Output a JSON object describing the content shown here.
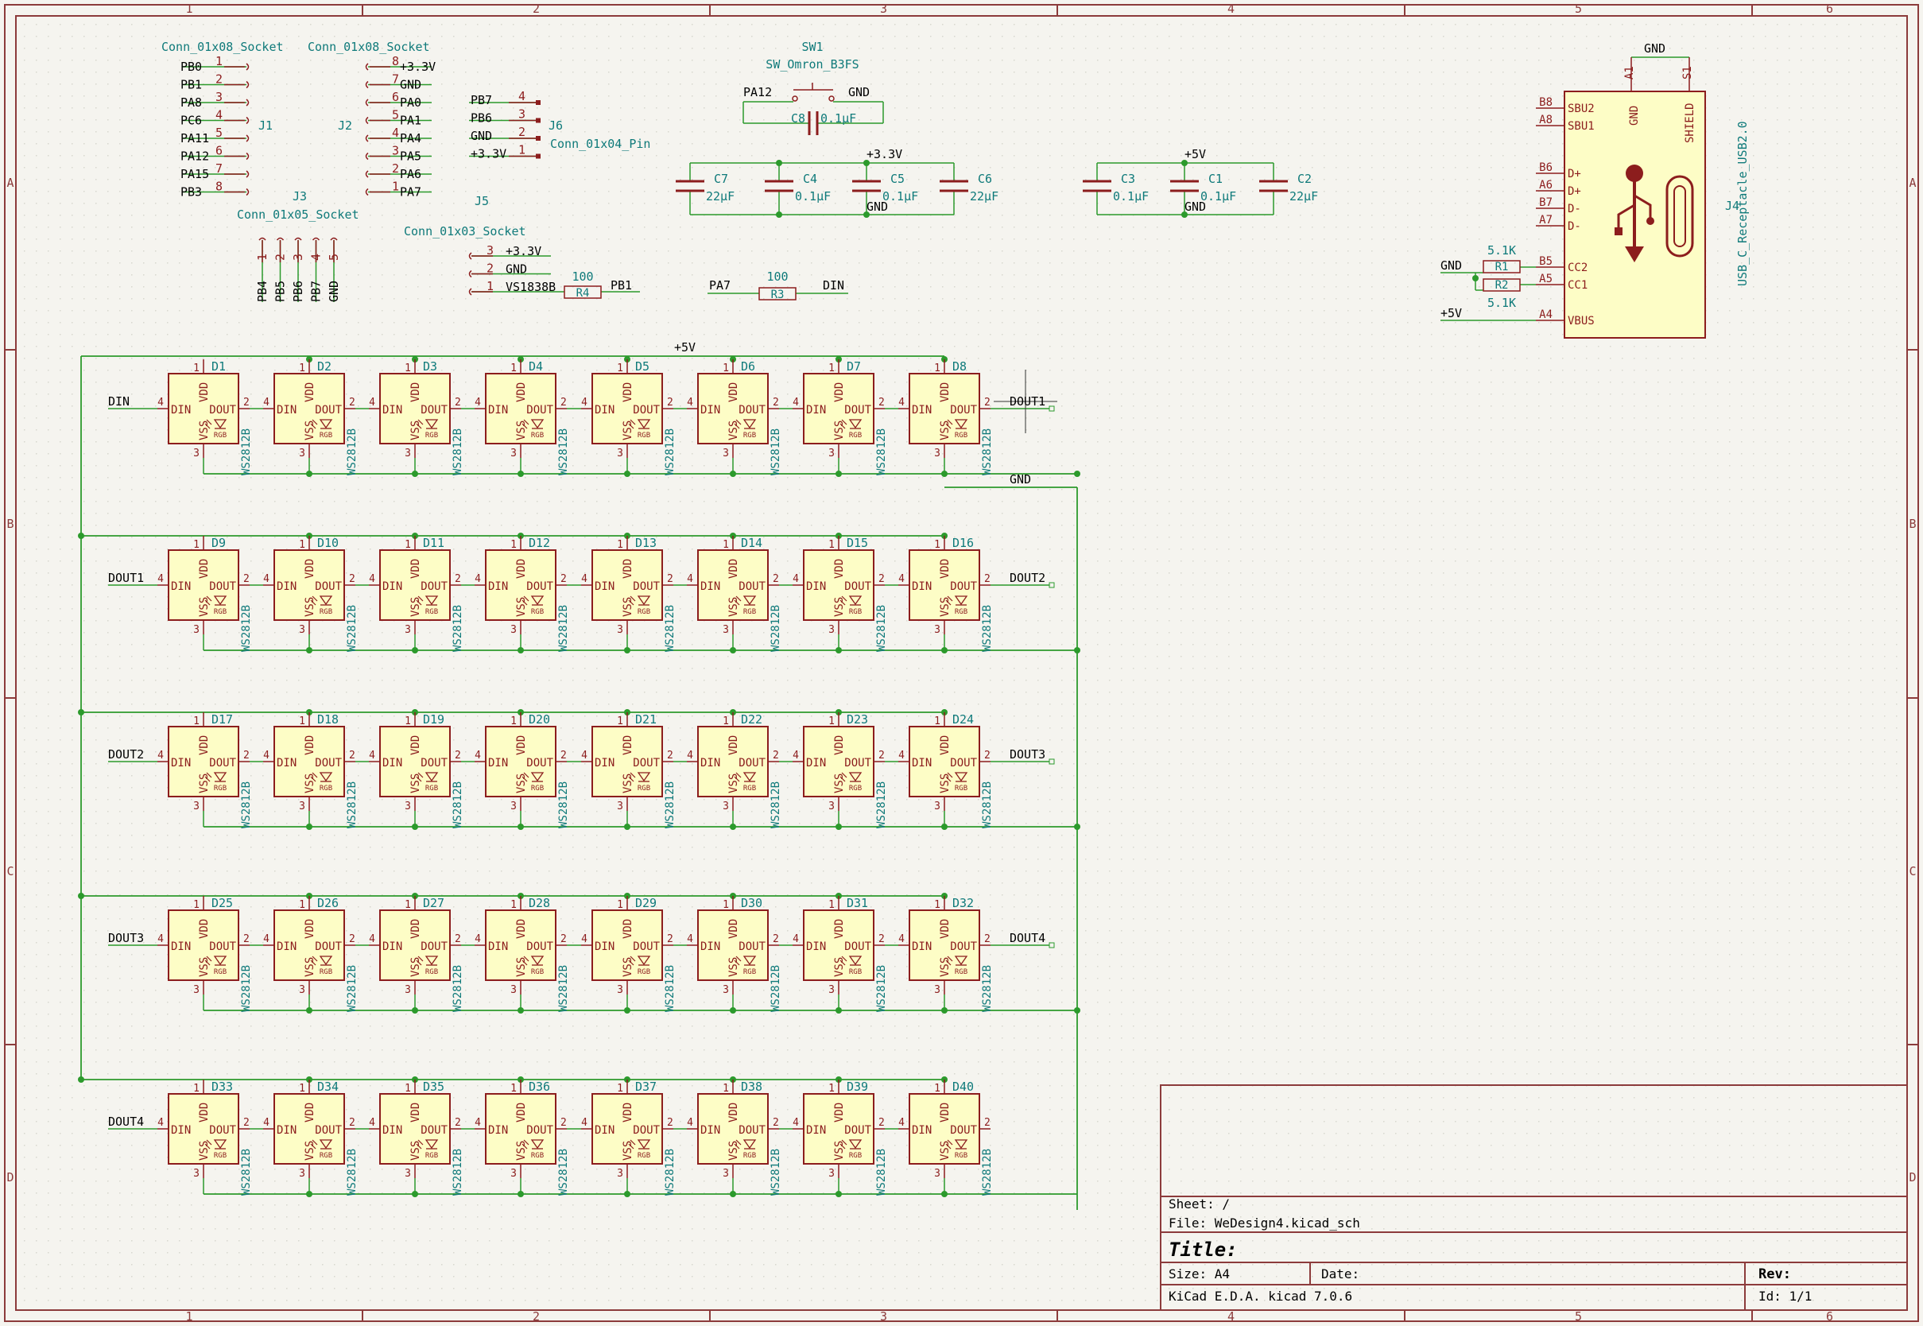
{
  "frame": {
    "col_labels": [
      "1",
      "2",
      "3",
      "4",
      "5",
      "6"
    ],
    "row_labels": [
      "A",
      "B",
      "C",
      "D"
    ]
  },
  "colors": {
    "background": "#f5f4ef",
    "border": "#8c3b3b",
    "wire": "#2c9a2c",
    "symbol_outline": "#8c1d1d",
    "symbol_fill": "#fdfdc6",
    "ref_text": "#0f7a7a",
    "pin_text": "#8c1d1d",
    "label_text": "#000000"
  },
  "connectors": {
    "j1": {
      "ref": "J1",
      "value": "Conn_01x08_Socket",
      "pins": [
        {
          "num": "1",
          "net": "PB0"
        },
        {
          "num": "2",
          "net": "PB1"
        },
        {
          "num": "3",
          "net": "PA8"
        },
        {
          "num": "4",
          "net": "PC6"
        },
        {
          "num": "5",
          "net": "PA11"
        },
        {
          "num": "6",
          "net": "PA12"
        },
        {
          "num": "7",
          "net": "PA15"
        },
        {
          "num": "8",
          "net": "PB3"
        }
      ]
    },
    "j2": {
      "ref": "J2",
      "value": "Conn_01x08_Socket",
      "pins": [
        {
          "num": "8",
          "net": "+3.3V"
        },
        {
          "num": "7",
          "net": "GND"
        },
        {
          "num": "6",
          "net": "PA0"
        },
        {
          "num": "5",
          "net": "PA1"
        },
        {
          "num": "4",
          "net": "PA4"
        },
        {
          "num": "3",
          "net": "PA5"
        },
        {
          "num": "2",
          "net": "PA6"
        },
        {
          "num": "1",
          "net": "PA7"
        }
      ]
    },
    "j3": {
      "ref": "J3",
      "value": "Conn_01x05_Socket",
      "pins": [
        {
          "num": "1",
          "net": "PB4"
        },
        {
          "num": "2",
          "net": "PB5"
        },
        {
          "num": "3",
          "net": "PB6"
        },
        {
          "num": "4",
          "net": "PB7"
        },
        {
          "num": "5",
          "net": "GND"
        }
      ]
    },
    "j5": {
      "ref": "J5",
      "value": "Conn_01x03_Socket",
      "pins": [
        {
          "num": "3",
          "net": "+3.3V"
        },
        {
          "num": "2",
          "net": "GND"
        },
        {
          "num": "1",
          "net": "VS1838B"
        }
      ]
    },
    "j6": {
      "ref": "J6",
      "value": "Conn_01x04_Pin",
      "pins": [
        {
          "num": "4",
          "net": "PB7"
        },
        {
          "num": "3",
          "net": "PB6"
        },
        {
          "num": "2",
          "net": "GND"
        },
        {
          "num": "1",
          "net": "+3.3V"
        }
      ]
    }
  },
  "resistors": {
    "r4": {
      "ref": "R4",
      "value": "100",
      "net_out": "PB1"
    },
    "r3": {
      "ref": "R3",
      "value": "100",
      "net_in": "PA7",
      "net_out": "DIN"
    },
    "r1": {
      "ref": "R1",
      "value": "5.1K"
    },
    "r2": {
      "ref": "R2",
      "value": "5.1K"
    }
  },
  "switch": {
    "ref": "SW1",
    "value": "SW_Omron_B3FS",
    "net_left": "PA12",
    "net_right": "GND"
  },
  "caps": {
    "c8": {
      "ref": "C8",
      "value": "0.1μF"
    },
    "c7": {
      "ref": "C7",
      "value": "22μF"
    },
    "c4": {
      "ref": "C4",
      "value": "0.1μF"
    },
    "c5": {
      "ref": "C5",
      "value": "0.1μF"
    },
    "c6": {
      "ref": "C6",
      "value": "22μF"
    },
    "c3": {
      "ref": "C3",
      "value": "0.1μF"
    },
    "c1": {
      "ref": "C1",
      "value": "0.1μF"
    },
    "c2": {
      "ref": "C2",
      "value": "22μF"
    },
    "bank1_top_net": "+3.3V",
    "bank1_bot_net": "GND",
    "bank2_top_net": "+5V",
    "bank2_bot_net": "GND"
  },
  "usb": {
    "ref": "J4",
    "value": "USB_C_Receptacle_USB2.0",
    "top_net": "GND",
    "top_pins": [
      {
        "num": "A1",
        "name": "GND"
      },
      {
        "num": "S1",
        "name": "SHIELD"
      }
    ],
    "left_pins": [
      {
        "num": "B8",
        "name": "SBU2"
      },
      {
        "num": "A8",
        "name": "SBU1"
      },
      {
        "num": "B6",
        "name": "D+"
      },
      {
        "num": "A6",
        "name": "D+"
      },
      {
        "num": "B7",
        "name": "D-"
      },
      {
        "num": "A7",
        "name": "D-"
      },
      {
        "num": "B5",
        "name": "CC2"
      },
      {
        "num": "A5",
        "name": "CC1"
      },
      {
        "num": "A4",
        "name": "VBUS"
      }
    ],
    "gnd_net": "GND",
    "vbus_net": "+5V"
  },
  "led_matrix": {
    "part": "WS2812B",
    "pin_vdd": "VDD",
    "pin_vss": "VSS",
    "pin_din": "DIN",
    "pin_dout": "DOUT",
    "pin_rgb": "RGB",
    "pin_num_vdd": "1",
    "pin_num_vss": "3",
    "pin_num_din": "4",
    "pin_num_dout": "2",
    "vcc_net": "+5V",
    "gnd_net": "GND",
    "rows": [
      {
        "in_net": "DIN",
        "out_net": "DOUT1",
        "refs": [
          "D1",
          "D2",
          "D3",
          "D4",
          "D5",
          "D6",
          "D7",
          "D8"
        ]
      },
      {
        "in_net": "DOUT1",
        "out_net": "DOUT2",
        "refs": [
          "D9",
          "D10",
          "D11",
          "D12",
          "D13",
          "D14",
          "D15",
          "D16"
        ]
      },
      {
        "in_net": "DOUT2",
        "out_net": "DOUT3",
        "refs": [
          "D17",
          "D18",
          "D19",
          "D20",
          "D21",
          "D22",
          "D23",
          "D24"
        ]
      },
      {
        "in_net": "DOUT3",
        "out_net": "DOUT4",
        "refs": [
          "D25",
          "D26",
          "D27",
          "D28",
          "D29",
          "D30",
          "D31",
          "D32"
        ]
      },
      {
        "in_net": "DOUT4",
        "out_net": "",
        "refs": [
          "D33",
          "D34",
          "D35",
          "D36",
          "D37",
          "D38",
          "D39",
          "D40"
        ]
      }
    ]
  },
  "title_block": {
    "sheet": "Sheet: /",
    "file": "File: WeDesign4.kicad_sch",
    "title": "Title:",
    "size": "Size: A4",
    "date": "Date:",
    "rev": "Rev:",
    "tool": "KiCad E.D.A.  kicad 7.0.6",
    "id": "Id: 1/1"
  }
}
